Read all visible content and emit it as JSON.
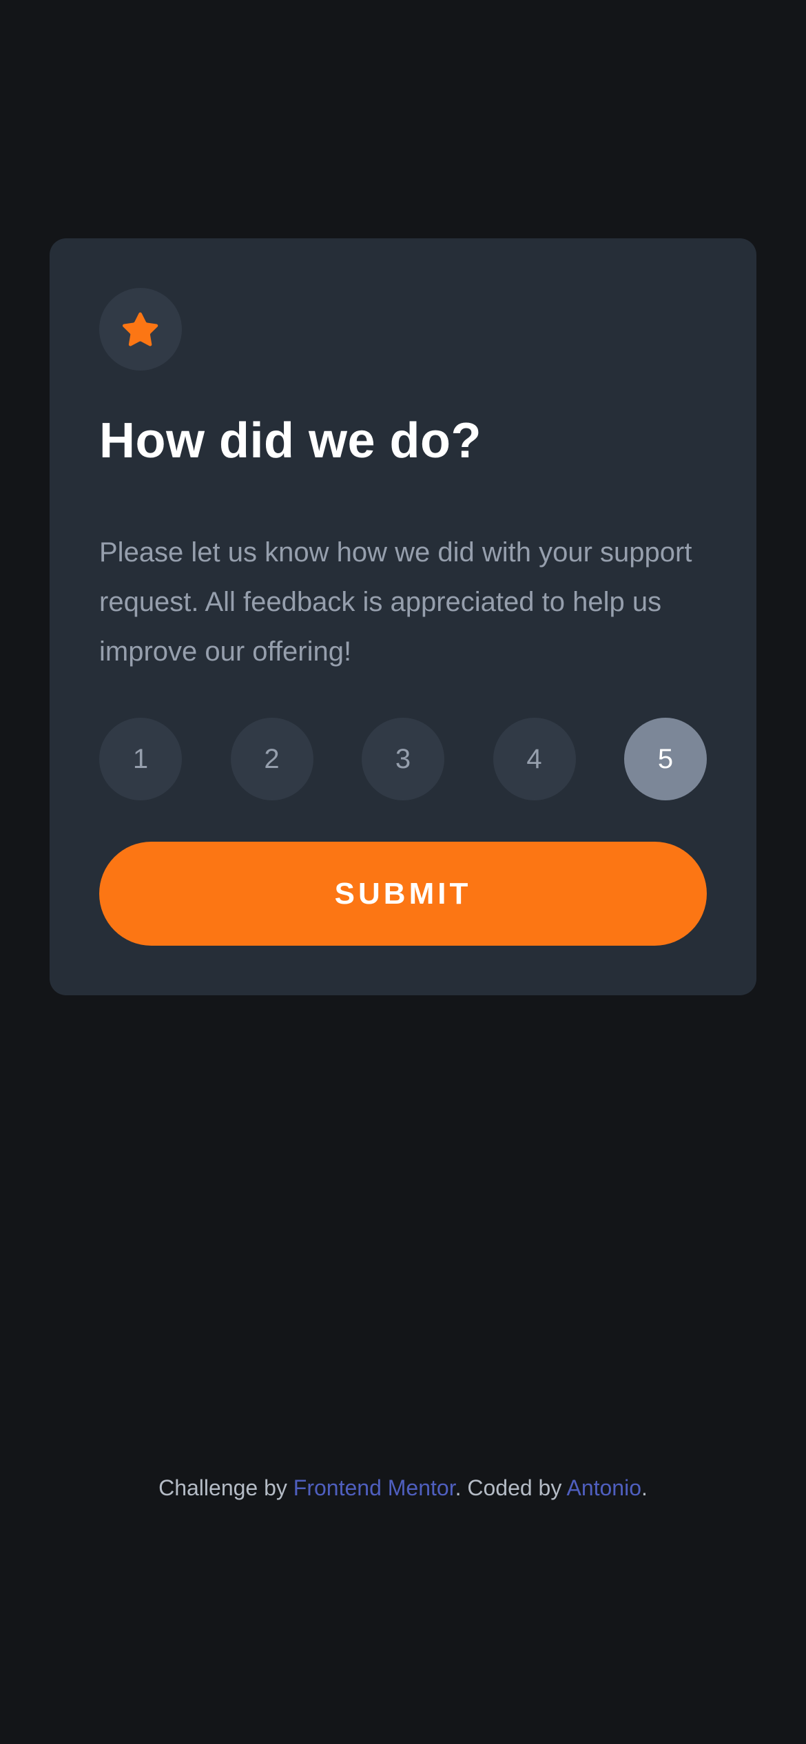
{
  "card": {
    "icon": "star-icon",
    "title": "How did we do?",
    "description": "Please let us know how we did with your support request. All feedback is appreciated to help us improve our offering!",
    "ratings": [
      "1",
      "2",
      "3",
      "4",
      "5"
    ],
    "selected_rating": "5",
    "submit_label": "SUBMIT"
  },
  "attribution": {
    "prefix": "Challenge by ",
    "link1": "Frontend Mentor",
    "middle": ". Coded by ",
    "link2": "Antonio",
    "suffix": "."
  },
  "colors": {
    "background": "#131518",
    "card": "#262e38",
    "accent": "#fc7614",
    "selected": "#7c8798",
    "link": "#4f5fbf"
  }
}
